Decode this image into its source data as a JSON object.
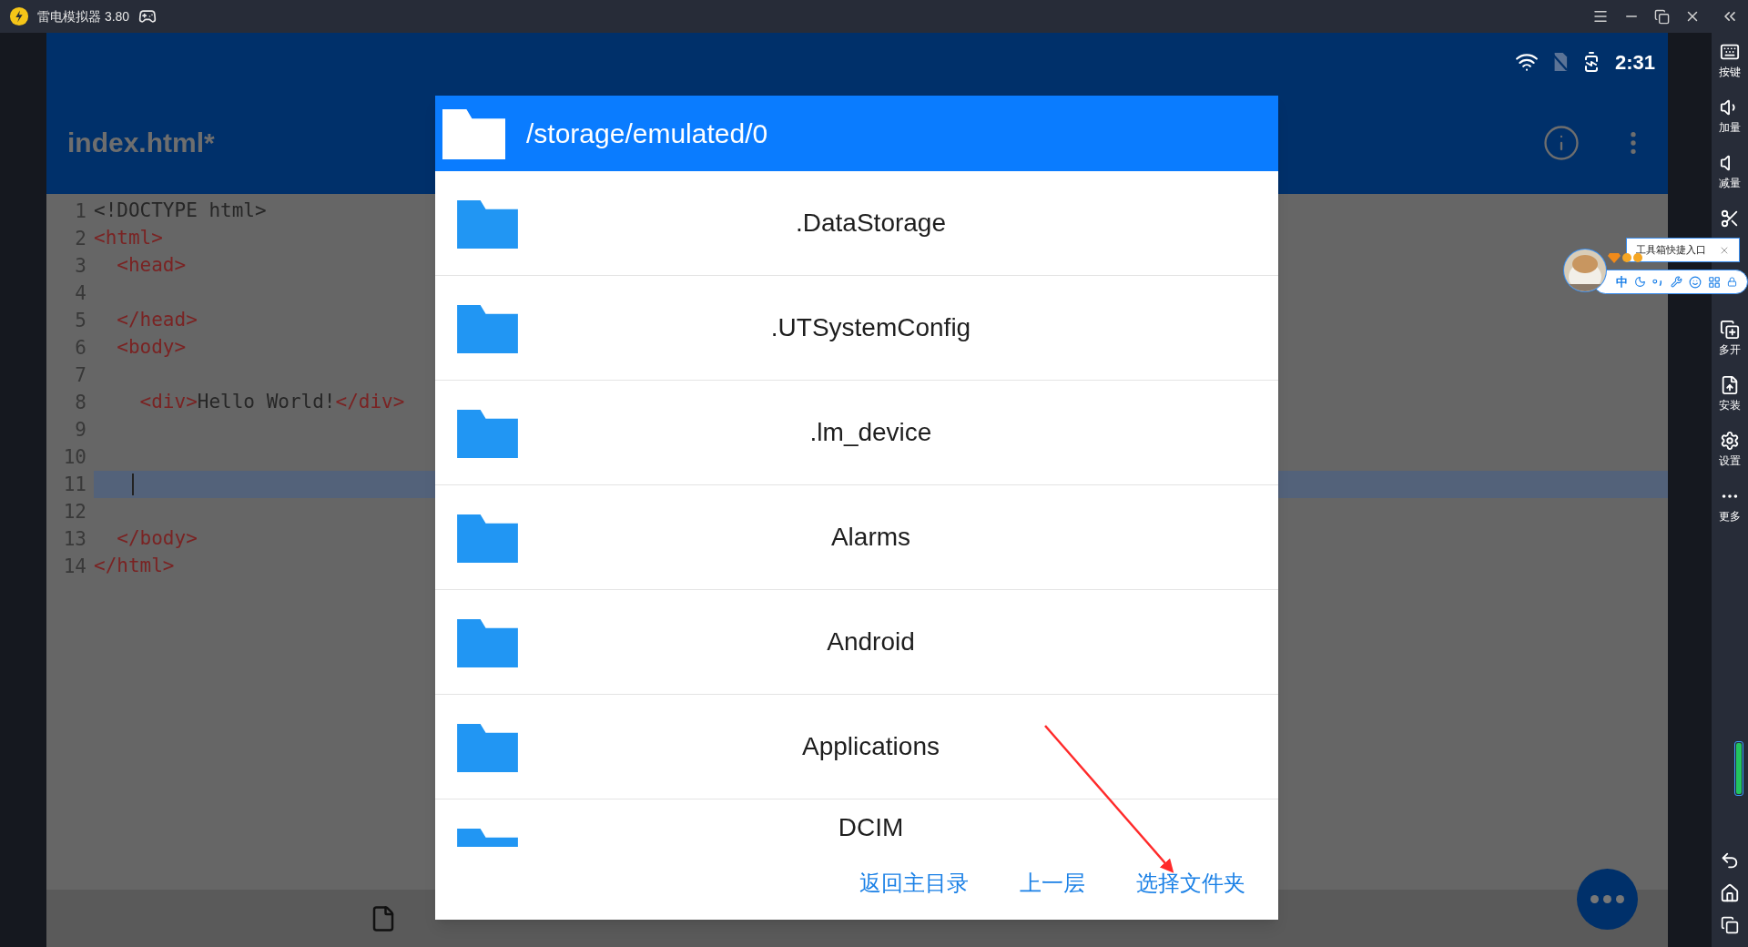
{
  "emulator": {
    "title": "雷电模拟器 3.80"
  },
  "status_bar": {
    "time": "2:31"
  },
  "app_bar": {
    "title": "index.html*"
  },
  "editor": {
    "lines": [
      {
        "number": "1",
        "selected": false,
        "tokens": [
          {
            "kind": "text",
            "text": "<!DOCTYPE html>"
          }
        ]
      },
      {
        "number": "2",
        "selected": false,
        "tokens": [
          {
            "kind": "tag",
            "text": "<html>"
          }
        ]
      },
      {
        "number": "3",
        "selected": false,
        "tokens": [
          {
            "kind": "tag",
            "text": "  <head>"
          }
        ]
      },
      {
        "number": "4",
        "selected": false
      },
      {
        "number": "5",
        "selected": false,
        "tokens": [
          {
            "kind": "tag",
            "text": "  </head>"
          }
        ]
      },
      {
        "number": "6",
        "selected": false,
        "tokens": [
          {
            "kind": "tag",
            "text": "  <body>"
          }
        ]
      },
      {
        "number": "7",
        "selected": false
      },
      {
        "number": "8",
        "selected": false,
        "tokens": [
          {
            "kind": "tag",
            "text": "    <div>"
          },
          {
            "kind": "text",
            "text": "Hello World!"
          },
          {
            "kind": "tag",
            "text": "</div>"
          }
        ]
      },
      {
        "number": "9",
        "selected": false
      },
      {
        "number": "10",
        "selected": false
      },
      {
        "number": "11",
        "selected": true
      },
      {
        "number": "12",
        "selected": false
      },
      {
        "number": "13",
        "selected": false,
        "tokens": [
          {
            "kind": "tag",
            "text": "  </body>"
          }
        ]
      },
      {
        "number": "14",
        "selected": false,
        "tokens": [
          {
            "kind": "tag",
            "text": "</html>"
          }
        ]
      }
    ]
  },
  "dialog": {
    "path": "/storage/emulated/0",
    "folders": [
      ".DataStorage",
      ".UTSystemConfig",
      ".lm_device",
      "Alarms",
      "Android",
      "Applications",
      "DCIM"
    ],
    "buttons": [
      "返回主目录",
      "上一层",
      "选择文件夹"
    ]
  },
  "toolbox": {
    "tooltip": "工具箱快捷入口",
    "input_mode": "中"
  },
  "sidebar": {
    "items": [
      {
        "kind": "keys",
        "label": "按键"
      },
      {
        "kind": "volume_up",
        "label": "加量"
      },
      {
        "kind": "volume_down",
        "label": "减量"
      },
      {
        "kind": "screenshot"
      },
      {
        "kind": "hidden"
      },
      {
        "kind": "multi",
        "label": "多开"
      },
      {
        "kind": "install",
        "label": "安装"
      },
      {
        "kind": "settings",
        "label": "设置"
      },
      {
        "kind": "more",
        "label": "更多"
      }
    ]
  }
}
